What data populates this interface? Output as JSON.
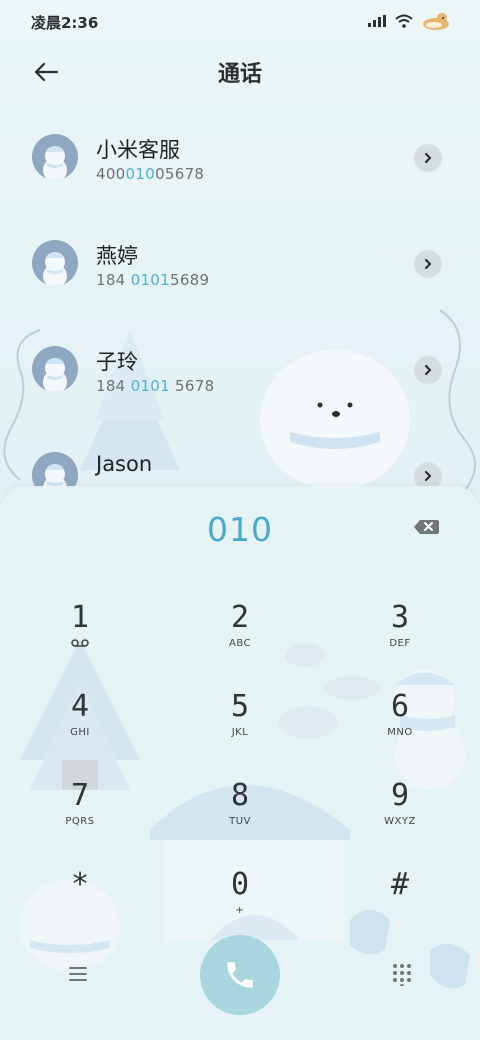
{
  "status_bar": {
    "time": "凌晨2:36"
  },
  "header": {
    "title": "通话"
  },
  "contacts": [
    {
      "name": "小米客服",
      "num_pre": "400",
      "num_hl": "010",
      "num_post": "05678"
    },
    {
      "name": "燕婷",
      "num_pre": "184 ",
      "num_hl": "0101",
      "num_post": "5689"
    },
    {
      "name": "子玲",
      "num_pre": "184 ",
      "num_hl": "0101",
      "num_post": " 5678"
    },
    {
      "name": "Jason",
      "num_pre": "",
      "num_hl": "",
      "num_post": ""
    }
  ],
  "dialer": {
    "input": "010",
    "keys": [
      {
        "digit": "1",
        "letters": ""
      },
      {
        "digit": "2",
        "letters": "ABC"
      },
      {
        "digit": "3",
        "letters": "DEF"
      },
      {
        "digit": "4",
        "letters": "GHI"
      },
      {
        "digit": "5",
        "letters": "JKL"
      },
      {
        "digit": "6",
        "letters": "MNO"
      },
      {
        "digit": "7",
        "letters": "PQRS"
      },
      {
        "digit": "8",
        "letters": "TUV"
      },
      {
        "digit": "9",
        "letters": "WXYZ"
      },
      {
        "digit": "*",
        "letters": ""
      },
      {
        "digit": "0",
        "letters": "+"
      },
      {
        "digit": "#",
        "letters": ""
      }
    ]
  },
  "icons": {
    "back": "arrow-left-icon",
    "chevron": "chevron-right-icon",
    "backspace": "backspace-icon",
    "voicemail": "voicemail-icon",
    "call": "phone-icon",
    "menu": "menu-icon",
    "keypad": "dialpad-icon"
  },
  "colors": {
    "accent": "#4db3d1",
    "call_button": "#a9d6df",
    "avatar": "#8ea8c1"
  }
}
